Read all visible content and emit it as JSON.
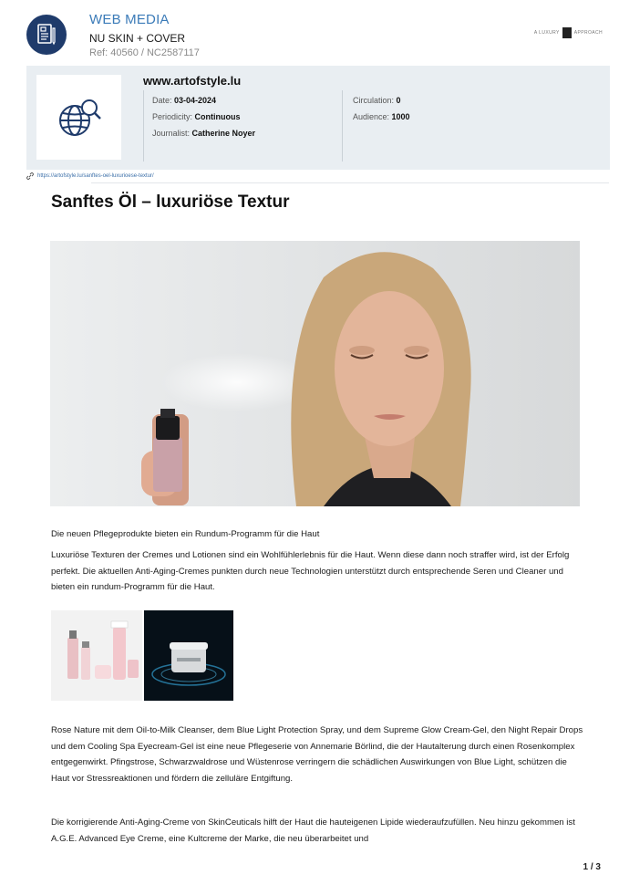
{
  "header": {
    "type_label": "WEB MEDIA",
    "client": "NU SKIN + COVER",
    "ref": "Ref: 40560 / NC2587117",
    "brand_text_left": "A LUXURY",
    "brand_text_right": "APPROACH",
    "icon": "document-icon"
  },
  "source": {
    "site": "www.artofstyle.lu",
    "date_label": "Date: ",
    "date": "03-04-2024",
    "periodicity_label": "Periodicity: ",
    "periodicity": "Continuous",
    "journalist_label": "Journalist: ",
    "journalist": "Catherine Noyer",
    "circulation_label": "Circulation: ",
    "circulation": "0",
    "audience_label": "Audience: ",
    "audience": "1000",
    "icon": "globe-search-icon"
  },
  "article": {
    "url": "https://artofstyle.lu/sanftes-oel-luxurioese-textur/",
    "title": "Sanftes Öl – luxuriöse Textur",
    "intro": "Die neuen Pflegeprodukte bieten ein Rundum-Programm für die Haut",
    "paragraph_1": "Luxuriöse Texturen der Cremes und Lotionen sind ein Wohlfühlerlebnis für die Haut. Wenn diese dann noch straffer wird, ist der Erfolg perfekt. Die aktuellen Anti-Aging-Cremes punkten durch neue Technologien unterstützt durch entsprechende Seren und Cleaner und bieten ein rundum-Programm für die Haut.",
    "paragraph_2": "Rose Nature mit dem Oil-to-Milk Cleanser, dem Blue Light Protection Spray, und dem Supreme Glow Cream-Gel, den Night Repair Drops und dem Cooling Spa Eyecream-Gel ist eine neue Pflegeserie von Annemarie Börlind, die der Hautalterung durch einen Rosenkomplex entgegenwirkt. Pfingstrose, Schwarzwaldrose und Wüstenrose verringern die schädlichen Auswirkungen von Blue Light, schützen die Haut vor Stressreaktionen und fördern die zelluläre Entgiftung.",
    "paragraph_3": "Die korrigierende Anti-Aging-Creme von SkinCeuticals hilft der Haut die hauteigenen Lipide wiederaufzufüllen. Neu hinzu gekommen ist A.G.E. Advanced Eye Creme, eine Kultcreme der Marke, die neu überarbeitet und"
  },
  "pager": "1 / 3"
}
